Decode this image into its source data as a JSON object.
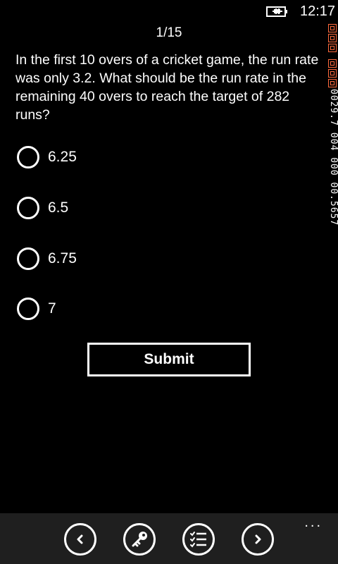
{
  "status": {
    "time": "12:17",
    "battery_icon": "battery-charging-icon"
  },
  "debug": {
    "text": "0029.7 004 000 00.5657"
  },
  "quiz": {
    "progress": "1/15",
    "question": "In the first 10 overs of a cricket game, the run rate was only 3.2. What should be the run rate in the remaining 40 overs to reach the target of 282 runs?",
    "options": [
      "6.25",
      "6.5",
      "6.75",
      "7"
    ],
    "submit_label": "Submit"
  },
  "app_bar": {
    "buttons": [
      "previous-icon",
      "key-icon",
      "checklist-icon",
      "next-icon"
    ],
    "more_label": "..."
  },
  "colors": {
    "background": "#000000",
    "foreground": "#ffffff",
    "app_bar": "#1f1f1f",
    "debug_accent": "#ff6a3d"
  }
}
